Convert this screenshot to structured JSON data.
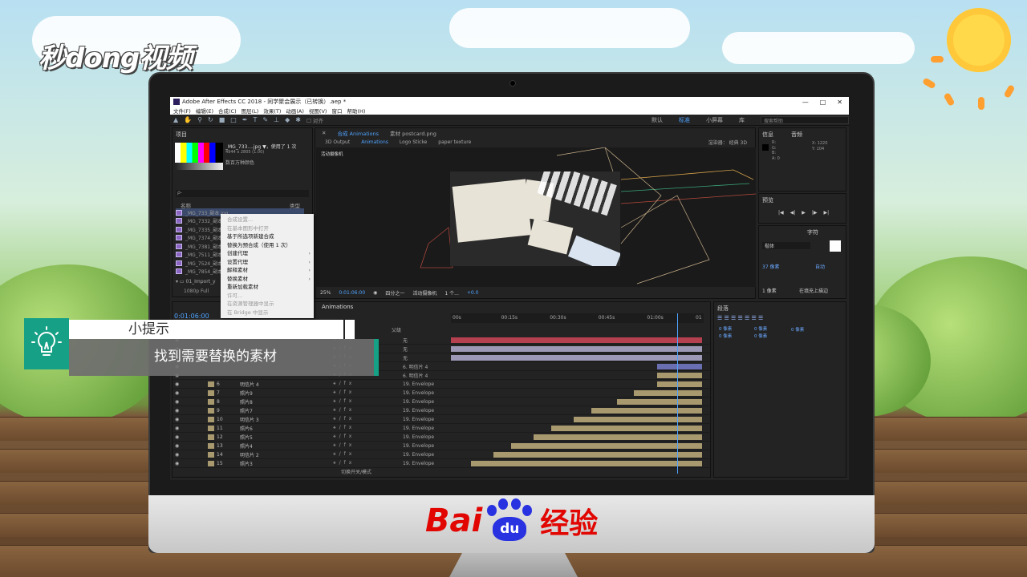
{
  "watermark": "秒dong视频",
  "brand": {
    "bai": "Bai",
    "du": "du",
    "jingyan": "经验"
  },
  "tip": {
    "heading": "小提示",
    "body": "找到需要替换的素材"
  },
  "app": {
    "title": "Adobe After Effects CC 2018 - 同学聚会展示（已转换）.aep *",
    "window_controls": [
      "—",
      "□",
      "✕"
    ],
    "menu": [
      "文件(F)",
      "编辑(E)",
      "合成(C)",
      "图层(L)",
      "效果(T)",
      "动画(A)",
      "视图(V)",
      "窗口",
      "帮助(H)"
    ],
    "align_label": "对齐",
    "workspaces": [
      "默认",
      "标准",
      "小屏幕",
      "库"
    ],
    "active_workspace": "标准",
    "search_placeholder": "搜索帮助"
  },
  "project": {
    "tab": "项目",
    "file_name": "_MG_733....jpg ▼，使用了 1 次",
    "file_dims": "4944 x 2805 (1.00)",
    "file_color": "数百万种颜色",
    "search_prompt": "ρ-",
    "col_name": "名称",
    "col_type": "类型",
    "items": [
      "_MG_733_副本.jpg",
      "_MG_7332_副本",
      "_MG_7335_副本",
      "_MG_7374_副本",
      "_MG_7381_副本",
      "_MG_7511_副本",
      "_MG_7524_副本",
      "_MG_7854_副本"
    ],
    "folder": "01_Import_y",
    "comp_entry": "1080p Full",
    "timecode": "0:01:06:00"
  },
  "context_menu": [
    {
      "label": "合成设置...",
      "dim": true
    },
    {
      "label": "在基本图形中打开",
      "dim": true
    },
    {
      "label": "基于所选项新建合成",
      "dim": false
    },
    {
      "label": "替换为预合成（使用 1 次）",
      "dim": false
    },
    {
      "label": "创建代理",
      "dim": false,
      "sub": true
    },
    {
      "label": "设置代理",
      "dim": false,
      "sub": true
    },
    {
      "label": "解释素材",
      "dim": false,
      "sub": true
    },
    {
      "label": "替换素材",
      "dim": false,
      "sub": true
    },
    {
      "label": "重新加载素材",
      "dim": false
    },
    {
      "label": "许可...",
      "dim": true
    },
    {
      "label": "在资源管理器中显示",
      "dim": true
    },
    {
      "label": "在 Bridge 中显示",
      "dim": true
    }
  ],
  "composition": {
    "tab_comp": "合成 Animations",
    "tab_footage": "素材 postcard.png",
    "subtabs": [
      "3D Output",
      "Animations",
      "Logo Sticke",
      "paper texture"
    ],
    "active_subtab": "Animations",
    "renderer_label": "渲染器：",
    "renderer": "经典 3D",
    "camera_label": "活动摄像机",
    "zoom": "25%",
    "timecode": "0:01:06:00",
    "resolution": "四分之一",
    "view": "活动摄像机",
    "views": "1 个...",
    "exposure": "+0.0"
  },
  "right": {
    "info_tab": "信息",
    "audio_tab": "音频",
    "info_values": [
      "R:",
      "G:",
      "B:",
      "A: 0"
    ],
    "coords": [
      "X: 1220",
      "Y: 104"
    ],
    "preview_tab": "预览",
    "char_tab": "字符",
    "font": "楷体",
    "size": "37 像素",
    "auto": "自动",
    "stroke": "1 像素",
    "stroke_mode": "在填充上描边",
    "para_tab": "段落",
    "para_values": [
      "0 像素",
      "0 像素",
      "0 像素",
      "0 像素",
      "0 像素"
    ]
  },
  "timeline": {
    "tab": "Animations",
    "parent_col": "父级",
    "ruler": [
      "00s",
      "00:15s",
      "00:30s",
      "00:45s",
      "01:00s",
      "01"
    ],
    "toggle_label": "切换开关/模式",
    "rows": [
      {
        "num": "",
        "name": "",
        "parent": "无",
        "color": "#b5404f",
        "start": 0.0,
        "end": 1.0
      },
      {
        "num": "",
        "name": "",
        "parent": "无",
        "color": "#9c98b5",
        "start": 0.0,
        "end": 1.0
      },
      {
        "num": "",
        "name": "",
        "parent": "无",
        "color": "#9c98b5",
        "start": 0.0,
        "end": 1.0
      },
      {
        "num": "",
        "name": "",
        "parent": "6. 明信片 4",
        "color": "#6a6fb2",
        "start": 0.82,
        "end": 1.0
      },
      {
        "num": "",
        "name": "",
        "parent": "6. 明信片 4",
        "color": "#a8996e",
        "start": 0.82,
        "end": 1.0
      },
      {
        "num": "6",
        "name": "明信片 4",
        "parent": "19. Envelope",
        "color": "#a8996e",
        "start": 0.82,
        "end": 1.0
      },
      {
        "num": "7",
        "name": "照片9",
        "parent": "19. Envelope",
        "color": "#a8996e",
        "start": 0.73,
        "end": 1.0
      },
      {
        "num": "8",
        "name": "照片8",
        "parent": "19. Envelope",
        "color": "#a8996e",
        "start": 0.66,
        "end": 1.0
      },
      {
        "num": "9",
        "name": "照片7",
        "parent": "19. Envelope",
        "color": "#a8996e",
        "start": 0.56,
        "end": 1.0
      },
      {
        "num": "10",
        "name": "明信片 3",
        "parent": "19. Envelope",
        "color": "#a8996e",
        "start": 0.49,
        "end": 1.0
      },
      {
        "num": "11",
        "name": "照片6",
        "parent": "19. Envelope",
        "color": "#a8996e",
        "start": 0.4,
        "end": 1.0
      },
      {
        "num": "12",
        "name": "照片5",
        "parent": "19. Envelope",
        "color": "#a8996e",
        "start": 0.33,
        "end": 1.0
      },
      {
        "num": "13",
        "name": "照片4",
        "parent": "19. Envelope",
        "color": "#a8996e",
        "start": 0.24,
        "end": 1.0
      },
      {
        "num": "14",
        "name": "明信片 2",
        "parent": "19. Envelope",
        "color": "#a8996e",
        "start": 0.17,
        "end": 1.0
      },
      {
        "num": "15",
        "name": "照片3",
        "parent": "19. Envelope",
        "color": "#a8996e",
        "start": 0.08,
        "end": 1.0
      }
    ]
  },
  "colors": {
    "accent": "#4fa3ff",
    "tip_green": "#16a085",
    "baidu_red": "#e10601",
    "baidu_blue": "#2932e1"
  }
}
